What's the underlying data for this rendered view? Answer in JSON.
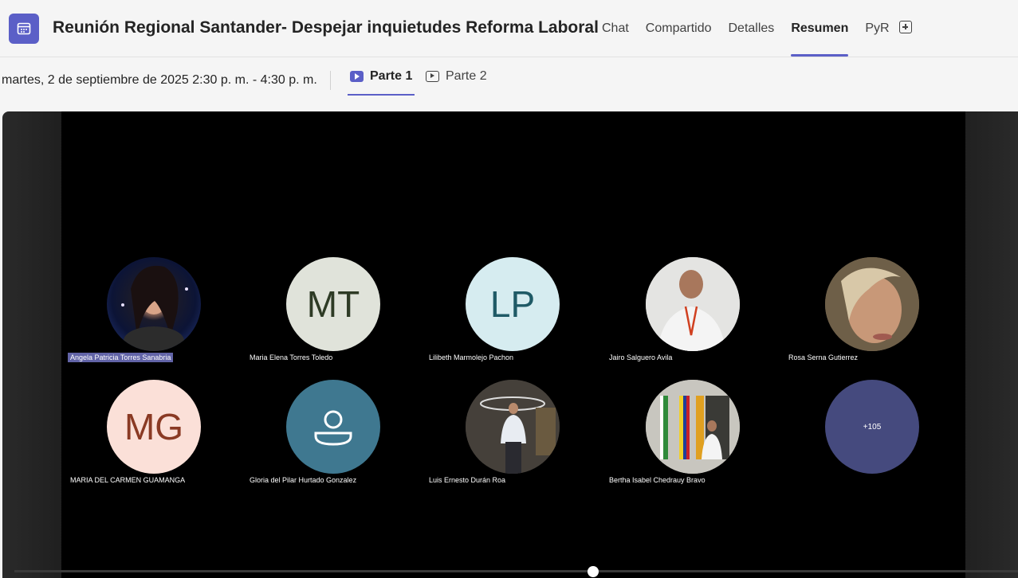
{
  "header": {
    "app_icon": "calendar-icon",
    "title": "Reunión Regional Santander- Despejar inquietudes Reforma Laboral",
    "tabs": [
      {
        "label": "Chat"
      },
      {
        "label": "Compartido"
      },
      {
        "label": "Detalles"
      },
      {
        "label": "Resumen",
        "active": true
      },
      {
        "label": "PyR"
      }
    ],
    "add_tab_icon": "plus-square-icon"
  },
  "subbar": {
    "date": "martes, 2 de septiembre de 2025 2:30 p. m. - 4:30 p. m.",
    "parts": [
      {
        "label": "Parte 1",
        "active": true
      },
      {
        "label": "Parte 2",
        "active": false
      }
    ]
  },
  "participants": [
    {
      "name": "Angela Patricia Torres Sanabria",
      "type": "photo",
      "highlighted": true
    },
    {
      "name": "Maria Elena Torres Toledo",
      "type": "initials",
      "initials": "MT",
      "bg": "#e0e3da",
      "fg": "#2e3b25"
    },
    {
      "name": "Lilibeth Marmolejo Pachon",
      "type": "initials",
      "initials": "LP",
      "bg": "#d6ecf0",
      "fg": "#1f5a66"
    },
    {
      "name": "Jairo Salguero Avila",
      "type": "photo"
    },
    {
      "name": "Rosa Serna Gutierrez",
      "type": "photo"
    },
    {
      "name": "MARIA DEL CARMEN GUAMANGA",
      "type": "initials",
      "initials": "MG",
      "bg": "#fbe0d8",
      "fg": "#8a3a24"
    },
    {
      "name": "Gloria del Pilar Hurtado Gonzalez",
      "type": "icon",
      "icon": "person-icon",
      "bg": "#3f7890"
    },
    {
      "name": "Luis Ernesto Durán Roa",
      "type": "photo"
    },
    {
      "name": "Bertha Isabel Chedrauy Bravo",
      "type": "photo"
    },
    {
      "name": "",
      "type": "overflow",
      "label": "+105",
      "bg": "#454a7e"
    }
  ],
  "playback": {
    "progress": 0.576
  }
}
